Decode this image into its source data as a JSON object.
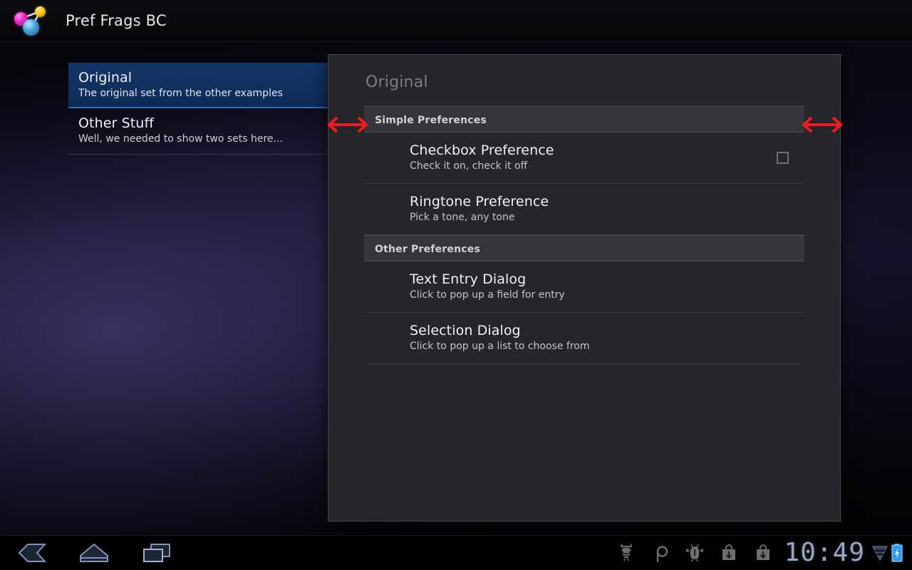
{
  "app": {
    "title": "Pref Frags BC",
    "icon": "molecule-icon"
  },
  "headers": {
    "items": [
      {
        "title": "Original",
        "summary": "The original set from the other examples",
        "selected": true
      },
      {
        "title": "Other Stuff",
        "summary": "Well, we needed to show two sets here...",
        "selected": false
      }
    ]
  },
  "prefs": {
    "title": "Original",
    "categories": [
      {
        "label": "Simple Preferences",
        "rows": [
          {
            "title": "Checkbox Preference",
            "summary": "Check it on, check it off",
            "widget": "checkbox",
            "checked": false
          },
          {
            "title": "Ringtone Preference",
            "summary": "Pick a tone, any tone",
            "widget": "none"
          }
        ]
      },
      {
        "label": "Other Preferences",
        "rows": [
          {
            "title": "Text Entry Dialog",
            "summary": "Click to pop up a field for entry",
            "widget": "none"
          },
          {
            "title": "Selection Dialog",
            "summary": "Click to pop up a list to choose from",
            "widget": "none"
          }
        ]
      }
    ]
  },
  "annotations": {
    "color": "#f01a20",
    "left_arrow": "double-headed-arrow-left",
    "right_arrow": "double-headed-arrow-right"
  },
  "systembar": {
    "nav": [
      {
        "name": "back-icon",
        "label": "Back"
      },
      {
        "name": "home-icon",
        "label": "Home"
      },
      {
        "name": "recents-icon",
        "label": "Recent apps"
      }
    ],
    "notifications": [
      {
        "name": "bee-icon"
      },
      {
        "name": "rho-icon"
      },
      {
        "name": "bug-icon"
      },
      {
        "name": "download-bag-icon"
      },
      {
        "name": "download-bag-icon-2"
      }
    ],
    "clock": "10:49",
    "wifi": "wifi-icon",
    "battery": "battery-charging-icon"
  }
}
